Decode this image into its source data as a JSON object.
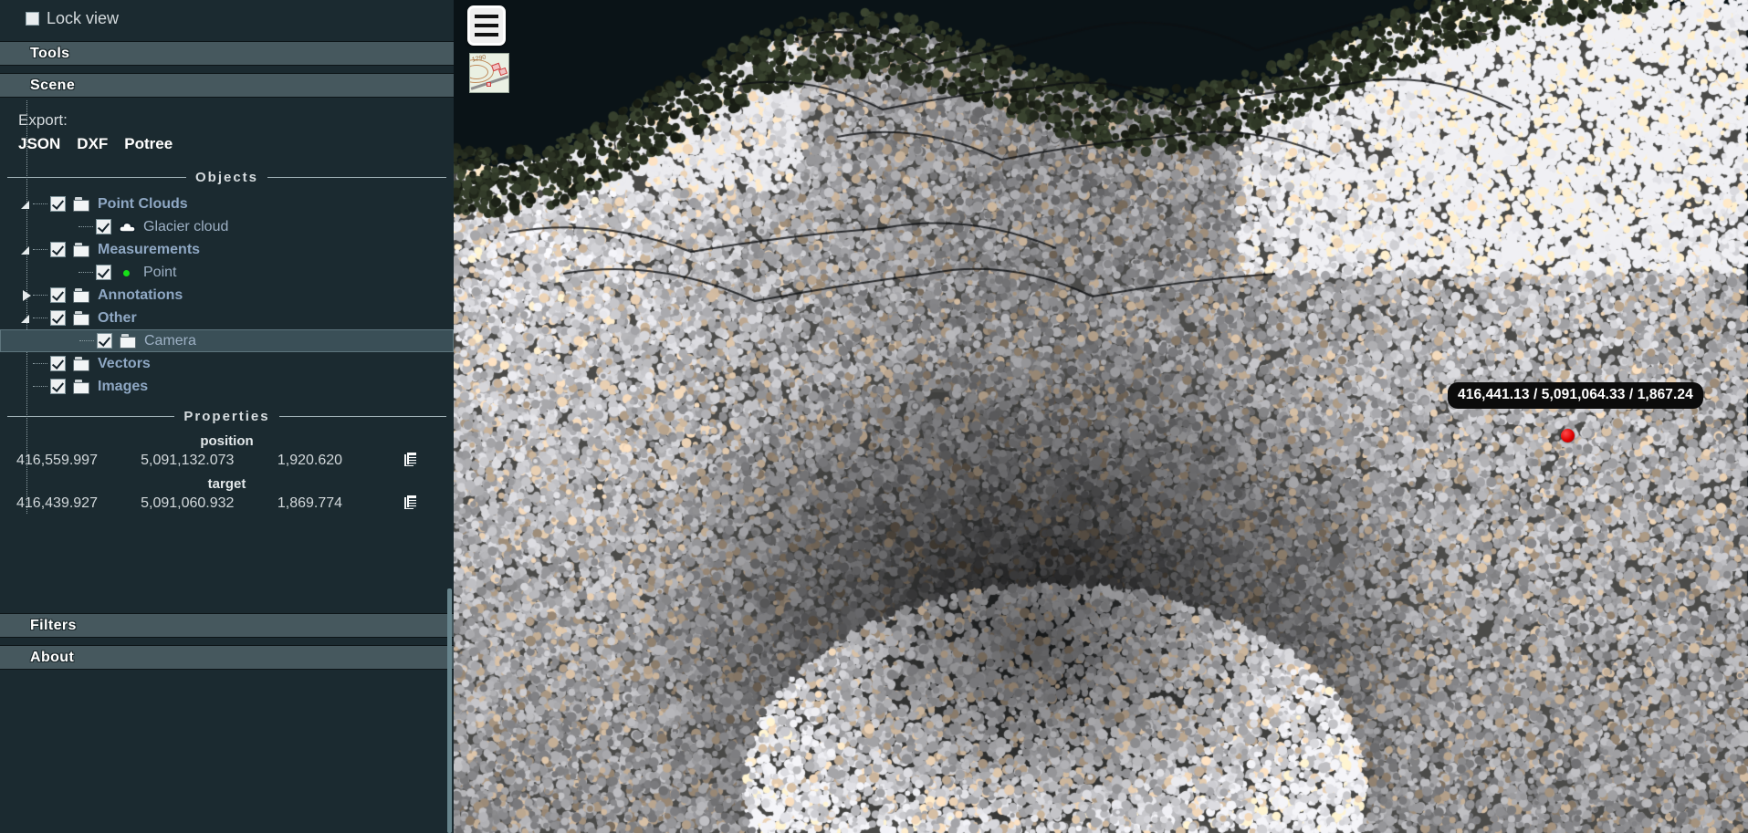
{
  "sidebar": {
    "lock_view": {
      "label": "Lock view",
      "checked": false
    },
    "accordions": {
      "tools": "Tools",
      "scene": "Scene",
      "filters": "Filters",
      "about": "About"
    },
    "export": {
      "label": "Export:",
      "options": [
        "JSON",
        "DXF",
        "Potree"
      ]
    },
    "objects": {
      "title": "Objects",
      "tree": [
        {
          "label": "Point Clouds",
          "icon": "folder-icon",
          "checked": true,
          "twisty": "open",
          "depth": 0,
          "bold": true,
          "selected": false
        },
        {
          "label": "Glacier cloud",
          "icon": "cloud-icon",
          "checked": true,
          "twisty": "none",
          "depth": 1,
          "bold": false,
          "selected": false
        },
        {
          "label": "Measurements",
          "icon": "folder-icon",
          "checked": true,
          "twisty": "open",
          "depth": 0,
          "bold": true,
          "selected": false
        },
        {
          "label": "Point",
          "icon": "point-icon",
          "checked": true,
          "twisty": "none",
          "depth": 1,
          "bold": false,
          "selected": false
        },
        {
          "label": "Annotations",
          "icon": "folder-icon",
          "checked": true,
          "twisty": "closed",
          "depth": 0,
          "bold": true,
          "selected": false
        },
        {
          "label": "Other",
          "icon": "folder-icon",
          "checked": true,
          "twisty": "open",
          "depth": 0,
          "bold": true,
          "selected": false
        },
        {
          "label": "Camera",
          "icon": "folder-icon",
          "checked": true,
          "twisty": "none",
          "depth": 1,
          "bold": false,
          "selected": true
        },
        {
          "label": "Vectors",
          "icon": "folder-icon",
          "checked": true,
          "twisty": "none",
          "depth": 0,
          "bold": true,
          "selected": false
        },
        {
          "label": "Images",
          "icon": "folder-icon",
          "checked": true,
          "twisty": "none",
          "depth": 0,
          "bold": true,
          "selected": false
        }
      ]
    },
    "properties": {
      "title": "Properties",
      "position": {
        "label": "position",
        "x": "416,559.997",
        "y": "5,091,132.073",
        "z": "1,920.620",
        "copy_icon": "copy-icon"
      },
      "target": {
        "label": "target",
        "x": "416,439.927",
        "y": "5,091,060.932",
        "z": "1,869.774",
        "copy_icon": "copy-icon"
      }
    }
  },
  "viewport": {
    "menu_icon": "hamburger-menu-icon",
    "map_thumbnail": {
      "icon": "map-thumbnail-icon",
      "contour_label": "1290"
    },
    "measurement": {
      "tooltip": "416,441.13 / 5,091,064.33 / 1,867.24",
      "marker_color": "#e00000"
    }
  },
  "colors": {
    "panel_bg": "#1b2a30",
    "accordion_bg": "#46585e",
    "tree_label": "#8fa8c4",
    "selected_row": "#3a4f57",
    "marker_red": "#e00000",
    "point_green": "#17e018"
  }
}
